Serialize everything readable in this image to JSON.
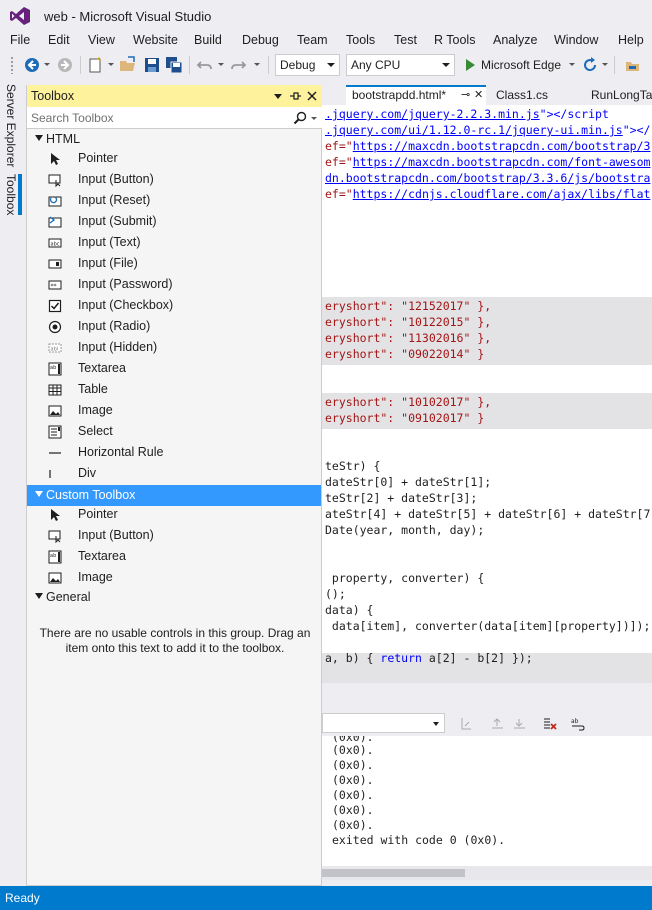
{
  "window": {
    "title": "web - Microsoft Visual Studio"
  },
  "menu": [
    "File",
    "Edit",
    "View",
    "Website",
    "Build",
    "Debug",
    "Team",
    "Tools",
    "Test",
    "R Tools",
    "Analyze",
    "Window",
    "Help"
  ],
  "toolbar": {
    "config": "Debug",
    "platform": "Any CPU",
    "run_target": "Microsoft Edge"
  },
  "side_tabs": [
    "Server Explorer",
    "Toolbox"
  ],
  "toolbox": {
    "title": "Toolbox",
    "search_placeholder": "Search Toolbox",
    "groups": [
      {
        "label": "HTML",
        "items": [
          "Pointer",
          "Input (Button)",
          "Input (Reset)",
          "Input (Submit)",
          "Input (Text)",
          "Input (File)",
          "Input (Password)",
          "Input (Checkbox)",
          "Input (Radio)",
          "Input (Hidden)",
          "Textarea",
          "Table",
          "Image",
          "Select",
          "Horizontal Rule",
          "Div"
        ]
      },
      {
        "label": "Custom Toolbox",
        "items": [
          "Pointer",
          "Input (Button)",
          "Textarea",
          "Image"
        ]
      },
      {
        "label": "General",
        "items": []
      }
    ],
    "empty_message": "There are no usable controls in this group. Drag an item onto this text to add it to the toolbox."
  },
  "editor": {
    "tabs": [
      "bootstrapdd.html*",
      "Class1.cs",
      "RunLongTa"
    ],
    "lines": {
      "l1_a": ".jquery.com/jquery-2.2.3.min.js",
      "l1_b": "\"></script",
      "l2_a": ".jquery.com/ui/1.12.0-rc.1/jquery-ui.min.js",
      "l2_b": "\"></",
      "l3_pre": "ef=\"",
      "l3_url": "https://maxcdn.bootstrapcdn.com/bootstrap/3",
      "l4_pre": "ef=\"",
      "l4_url": "https://maxcdn.bootstrapcdn.com/font-awesom",
      "l5_url": "dn.bootstrapcdn.com/bootstrap/3.3.6/js/bootstra",
      "l6_pre": "ef=\"",
      "l6_url": "https://cdnjs.cloudflare.com/ajax/libs/flat",
      "d1": "eryshort\": \"12152017\" },",
      "d2": "eryshort\": \"10122015\" },",
      "d3": "eryshort\": \"11302016\" },",
      "d4": "eryshort\": \"09022014\" }",
      "d5": "eryshort\": \"10102017\" },",
      "d6": "eryshort\": \"09102017\" }",
      "c1": "teStr) {",
      "c2": "dateStr[0] + dateStr[1];",
      "c3": "teStr[2] + dateStr[3];",
      "c4": "ateStr[4] + dateStr[5] + dateStr[6] + dateStr[7",
      "c5": "Date(year, month, day);",
      "c6": " property, converter) {",
      "c7": "();",
      "c8": "data) {",
      "c9": " data[item], converter(data[item][property])]);",
      "c10_a": "a, b) { ",
      "c10_kw": "return",
      "c10_b": " a[2] - b[2] });"
    }
  },
  "output": {
    "lines": [
      "(0x0).",
      "(0x0).",
      "(0x0).",
      "(0x0).",
      "(0x0).",
      "(0x0).",
      "(0x0).",
      "exited with code 0 (0x0)."
    ]
  },
  "status": {
    "text": "Ready"
  },
  "colors": {
    "accent": "#007acc",
    "toolbox_header": "#fff29d",
    "selection": "#3399ff"
  }
}
